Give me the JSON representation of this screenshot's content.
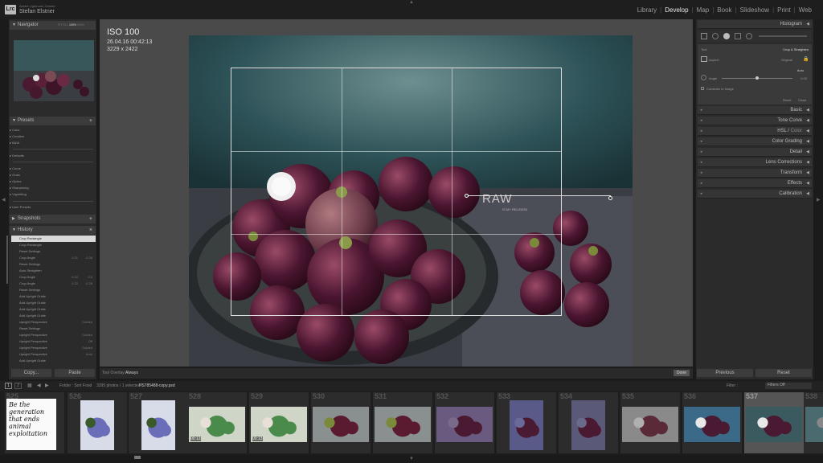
{
  "app": {
    "name": "Adobe Lightroom Classic",
    "user": "Stefan Elstner",
    "logo": "Lrc"
  },
  "modules": [
    {
      "label": "Library",
      "active": false
    },
    {
      "label": "Develop",
      "active": true
    },
    {
      "label": "Map",
      "active": false
    },
    {
      "label": "Book",
      "active": false
    },
    {
      "label": "Slideshow",
      "active": false
    },
    {
      "label": "Print",
      "active": false
    },
    {
      "label": "Web",
      "active": false
    }
  ],
  "left": {
    "navigator": {
      "title": "Navigator",
      "zoom": [
        "FIT",
        "FILL",
        "100%",
        "400%"
      ]
    },
    "presets": {
      "title": "Presets",
      "groups1": [
        "Color",
        "Creative",
        "B&W"
      ],
      "defaults": "Defaults",
      "groups2": [
        "Curve",
        "Grain",
        "Optics",
        "Sharpening",
        "Vignetting"
      ],
      "user": "User Presets"
    },
    "snapshots": {
      "title": "Snapshots"
    },
    "history": {
      "title": "History",
      "items": [
        {
          "label": "Crop Rectangle",
          "v1": "",
          "v2": ""
        },
        {
          "label": "Crop Rectangle",
          "v1": "",
          "v2": ""
        },
        {
          "label": "Reset Settings",
          "v1": "",
          "v2": ""
        },
        {
          "label": "Crop Angle",
          "v1": "0.21",
          "v2": "-0.36"
        },
        {
          "label": "Reset Settings",
          "v1": "",
          "v2": ""
        },
        {
          "label": "Auto Straighten",
          "v1": "",
          "v2": ""
        },
        {
          "label": "Crop Angle",
          "v1": "0.22",
          "v2": "0.0"
        },
        {
          "label": "Crop Angle",
          "v1": "0.22",
          "v2": "-0.28"
        },
        {
          "label": "Reset Settings",
          "v1": "",
          "v2": ""
        },
        {
          "label": "Add Upright Guide",
          "v1": "",
          "v2": ""
        },
        {
          "label": "Add Upright Guide",
          "v1": "",
          "v2": ""
        },
        {
          "label": "Add Upright Guide",
          "v1": "",
          "v2": ""
        },
        {
          "label": "Add Upright Guide",
          "v1": "",
          "v2": ""
        },
        {
          "label": "Upright Perspective",
          "v1": "",
          "v2": "Guided"
        },
        {
          "label": "Reset Settings",
          "v1": "",
          "v2": ""
        },
        {
          "label": "Upright Perspective",
          "v1": "",
          "v2": "Guided"
        },
        {
          "label": "Upright Perspective",
          "v1": "",
          "v2": "Off"
        },
        {
          "label": "Upright Perspective",
          "v1": "",
          "v2": "Guided"
        },
        {
          "label": "Upright Perspective",
          "v1": "",
          "v2": "Auto"
        },
        {
          "label": "Add Upright Guide",
          "v1": "",
          "v2": ""
        }
      ]
    },
    "copy": "Copy...",
    "paste": "Paste"
  },
  "photo": {
    "iso": "ISO 100",
    "date": "26.04.16 00:42:13",
    "dims": "3229 x 2422",
    "watermark": "RAW",
    "watermark_sub": "IS MY RELIGION"
  },
  "toolbar": {
    "overlay_label": "Tool Overlay :",
    "overlay_value": "Always",
    "done": "Done"
  },
  "right": {
    "histogram": "Histogram",
    "crop": {
      "tool": "Tool",
      "title": "Crop & Straighten",
      "aspect": "Aspect :",
      "aspect_value": "Original",
      "auto": "Auto",
      "angle": "Angle",
      "angle_value": "0.00",
      "constrain": "Constrain to Image",
      "reset": "Reset",
      "close": "Close"
    },
    "sections": [
      "Basic",
      "Tone Curve",
      "Color Grading",
      "Detail",
      "Lens Corrections",
      "Transform",
      "Effects",
      "Calibration"
    ],
    "hsl": {
      "a": "HSL",
      "b": "Color"
    },
    "previous": "Previous",
    "reset": "Reset"
  },
  "filmstrip": {
    "pages": [
      "1",
      "2"
    ],
    "folder": "Folder : Sort Food",
    "count": "3295 photos / 1 selected /",
    "file": "PS785488-copy.psd",
    "filter_label": "Filter :",
    "filter_value": "Filters Off",
    "numbers": [
      "525",
      "526",
      "527",
      "528",
      "529",
      "530",
      "531",
      "532",
      "533",
      "534",
      "535",
      "536",
      "537",
      "538"
    ],
    "handwriting": "Be the generation that ends animal exploitation",
    "badges": [
      "00:13",
      "00:13"
    ]
  },
  "colors": {
    "accent": "#e6e6e6",
    "panel": "#2b2b2b",
    "header": "#3b3b3b",
    "background": "#1b1b1b"
  }
}
